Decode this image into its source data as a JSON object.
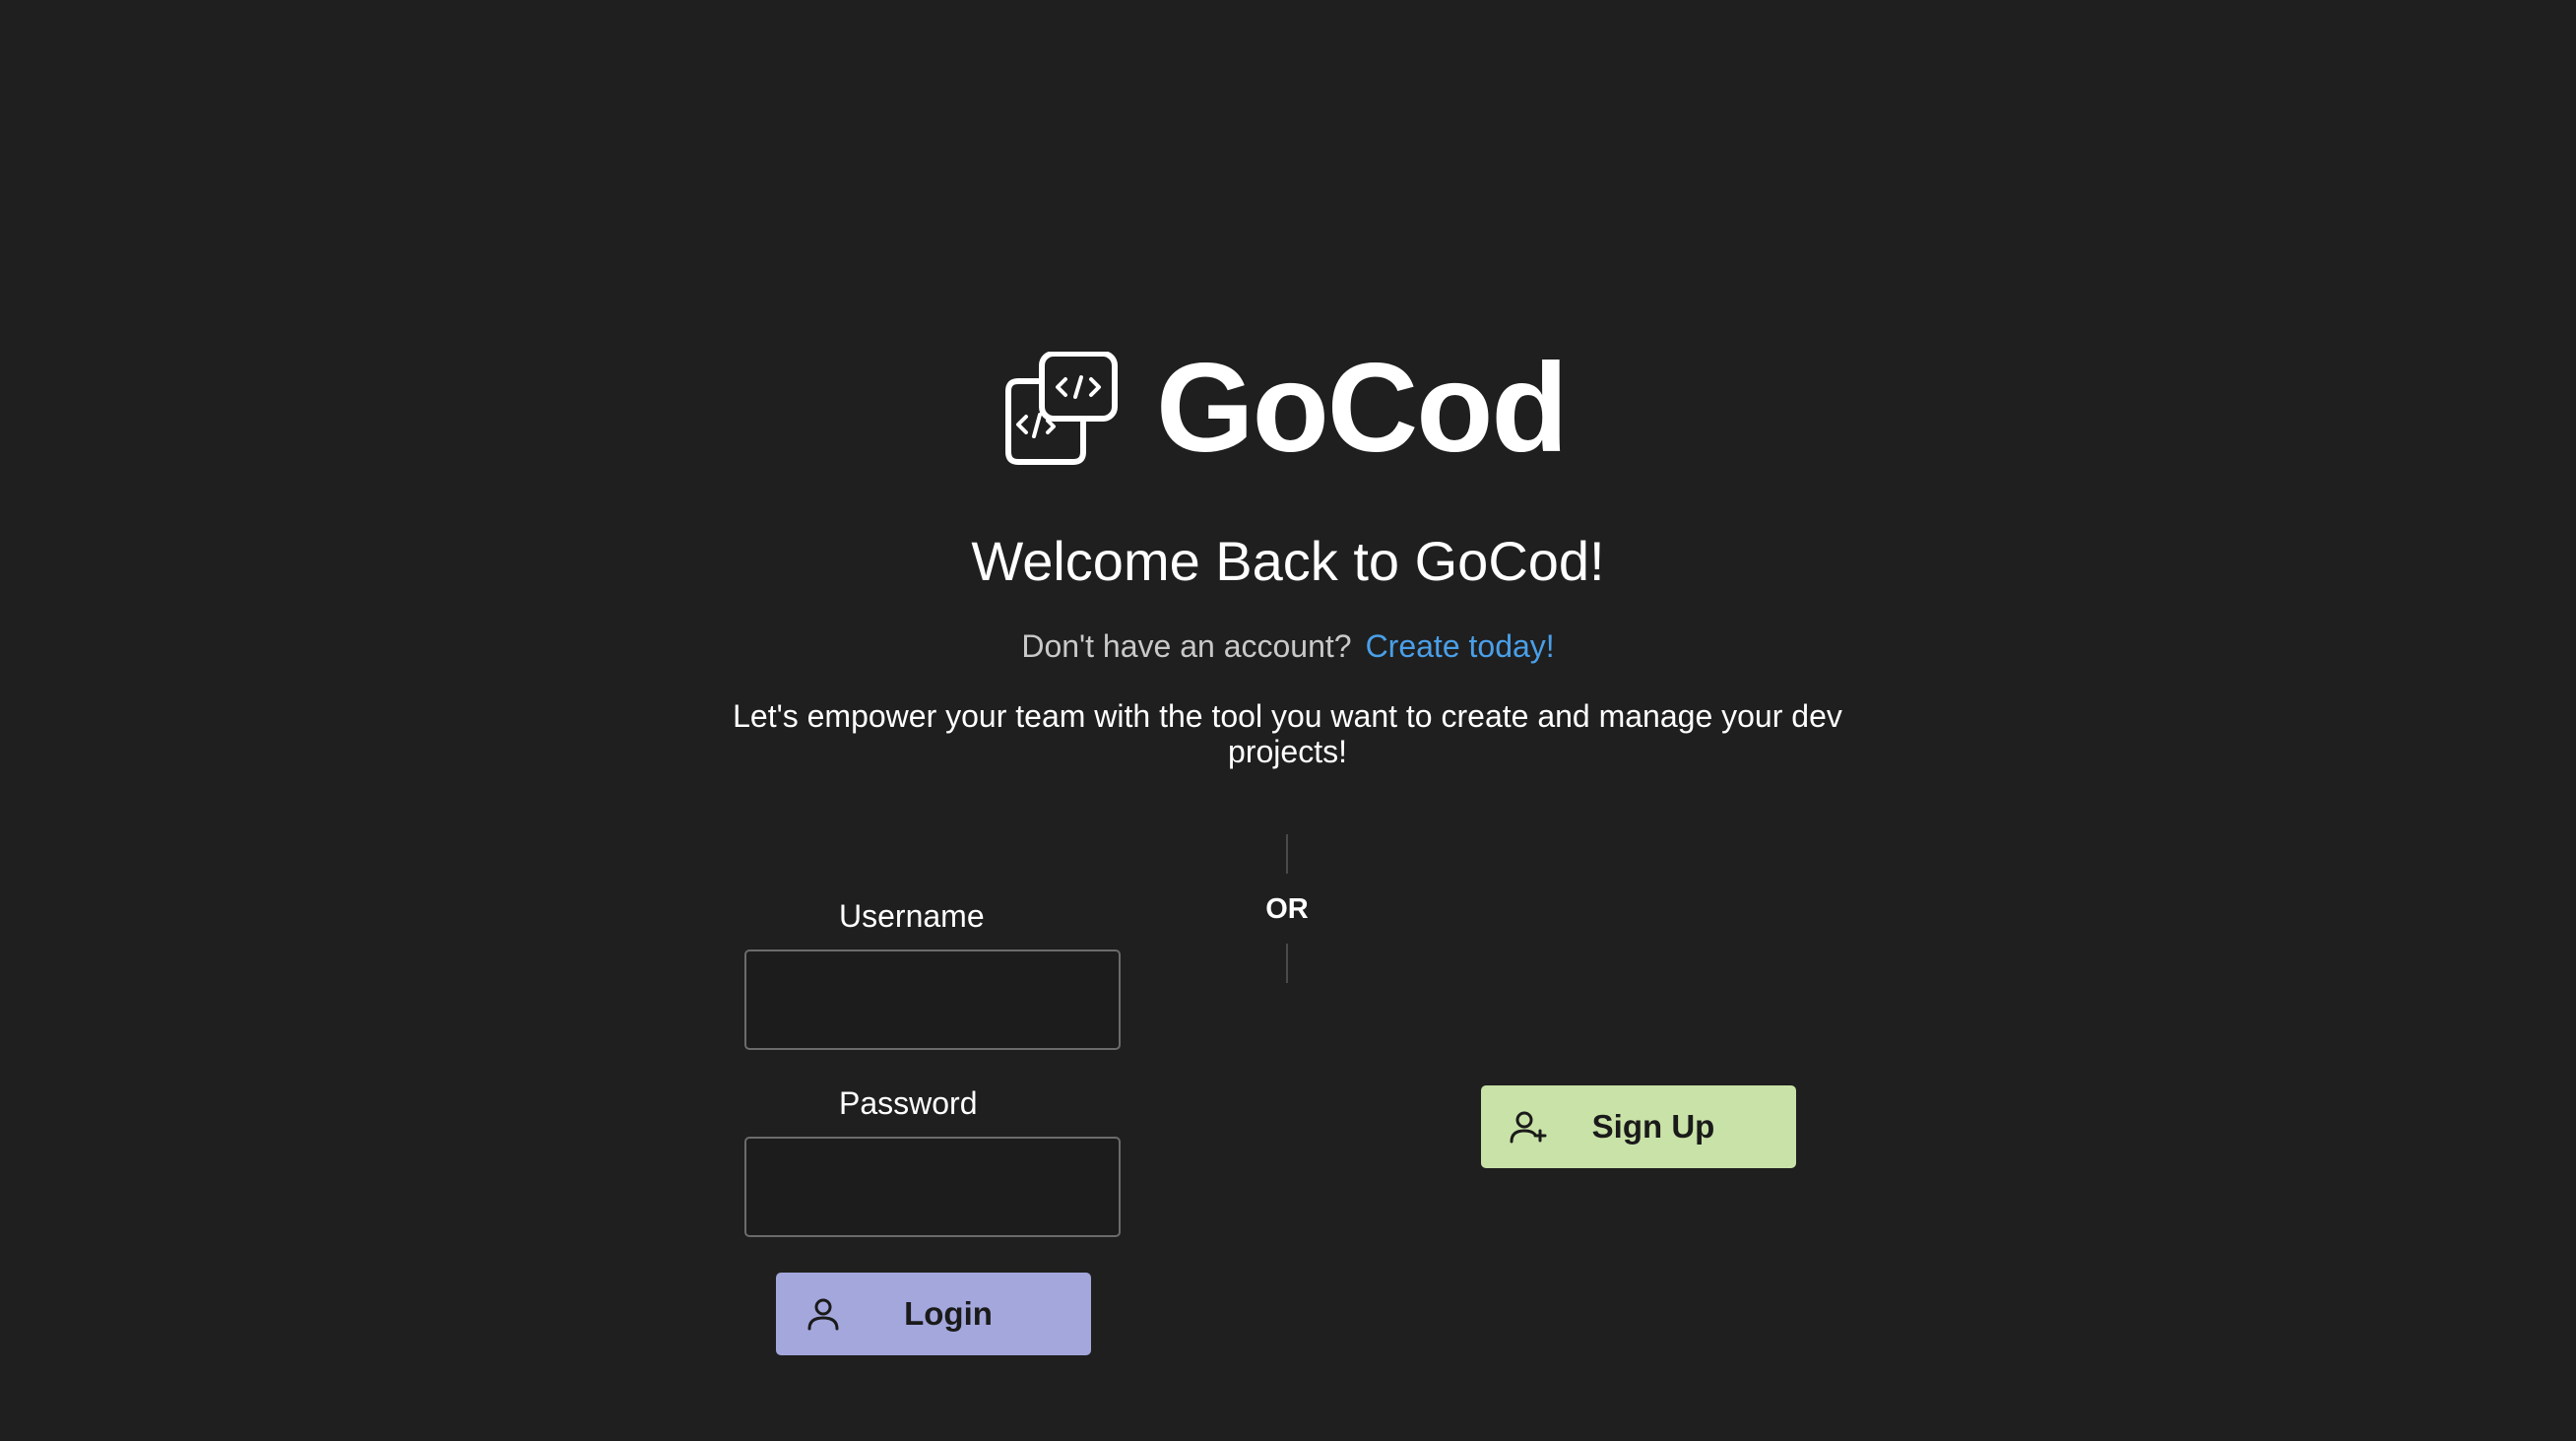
{
  "brand": {
    "name": "GoCod",
    "logo_icon": "code-windows-icon"
  },
  "header": {
    "welcome_title": "Welcome Back to GoCod!",
    "account_prompt": "Don't have an account?",
    "create_link": "Create today!",
    "tagline": "Let's empower your team with the tool you want to create and manage your dev projects!"
  },
  "login_form": {
    "username_label": "Username",
    "username_value": "",
    "password_label": "Password",
    "password_value": "",
    "login_button": "Login",
    "login_icon": "user-icon"
  },
  "separator": {
    "label": "OR"
  },
  "signup": {
    "button_label": "Sign Up",
    "icon": "user-plus-icon"
  },
  "colors": {
    "background": "#1f1f1f",
    "link": "#4a9fe8",
    "login_button": "#a3a7db",
    "signup_button": "#c9e2a8"
  }
}
